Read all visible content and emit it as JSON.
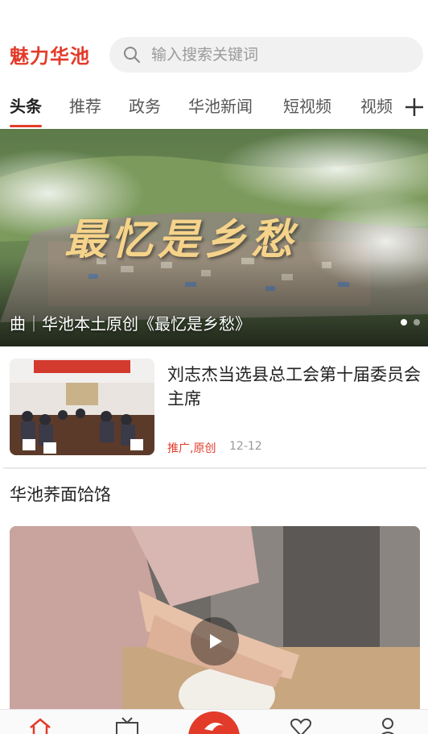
{
  "app": {
    "logo_text": "魅力华池"
  },
  "search": {
    "placeholder": "输入搜索关键词"
  },
  "tabs": [
    {
      "label": "头条",
      "active": true
    },
    {
      "label": "推荐",
      "active": false
    },
    {
      "label": "政务",
      "active": false
    },
    {
      "label": "华池新闻",
      "active": false
    },
    {
      "label": "短视频",
      "active": false
    },
    {
      "label": "视频",
      "active": false
    }
  ],
  "banner": {
    "art_title": "最忆是乡愁",
    "caption": "曲｜华池本土原创《最忆是乡愁》",
    "dots": 2,
    "active_dot": 0
  },
  "news": [
    {
      "title": "刘志杰当选县总工会第十届委员会主席",
      "tag": "推广,原创",
      "date": "12-12"
    }
  ],
  "video_section": {
    "title": "华池荞面饸饹"
  },
  "bottom_nav": {
    "items": [
      "home-icon",
      "tv-icon",
      "center-logo-icon",
      "heart-icon",
      "user-icon"
    ]
  },
  "colors": {
    "accent": "#e23b2a",
    "text": "#222222",
    "muted": "#999999",
    "search_bg": "#f1f1f1"
  }
}
